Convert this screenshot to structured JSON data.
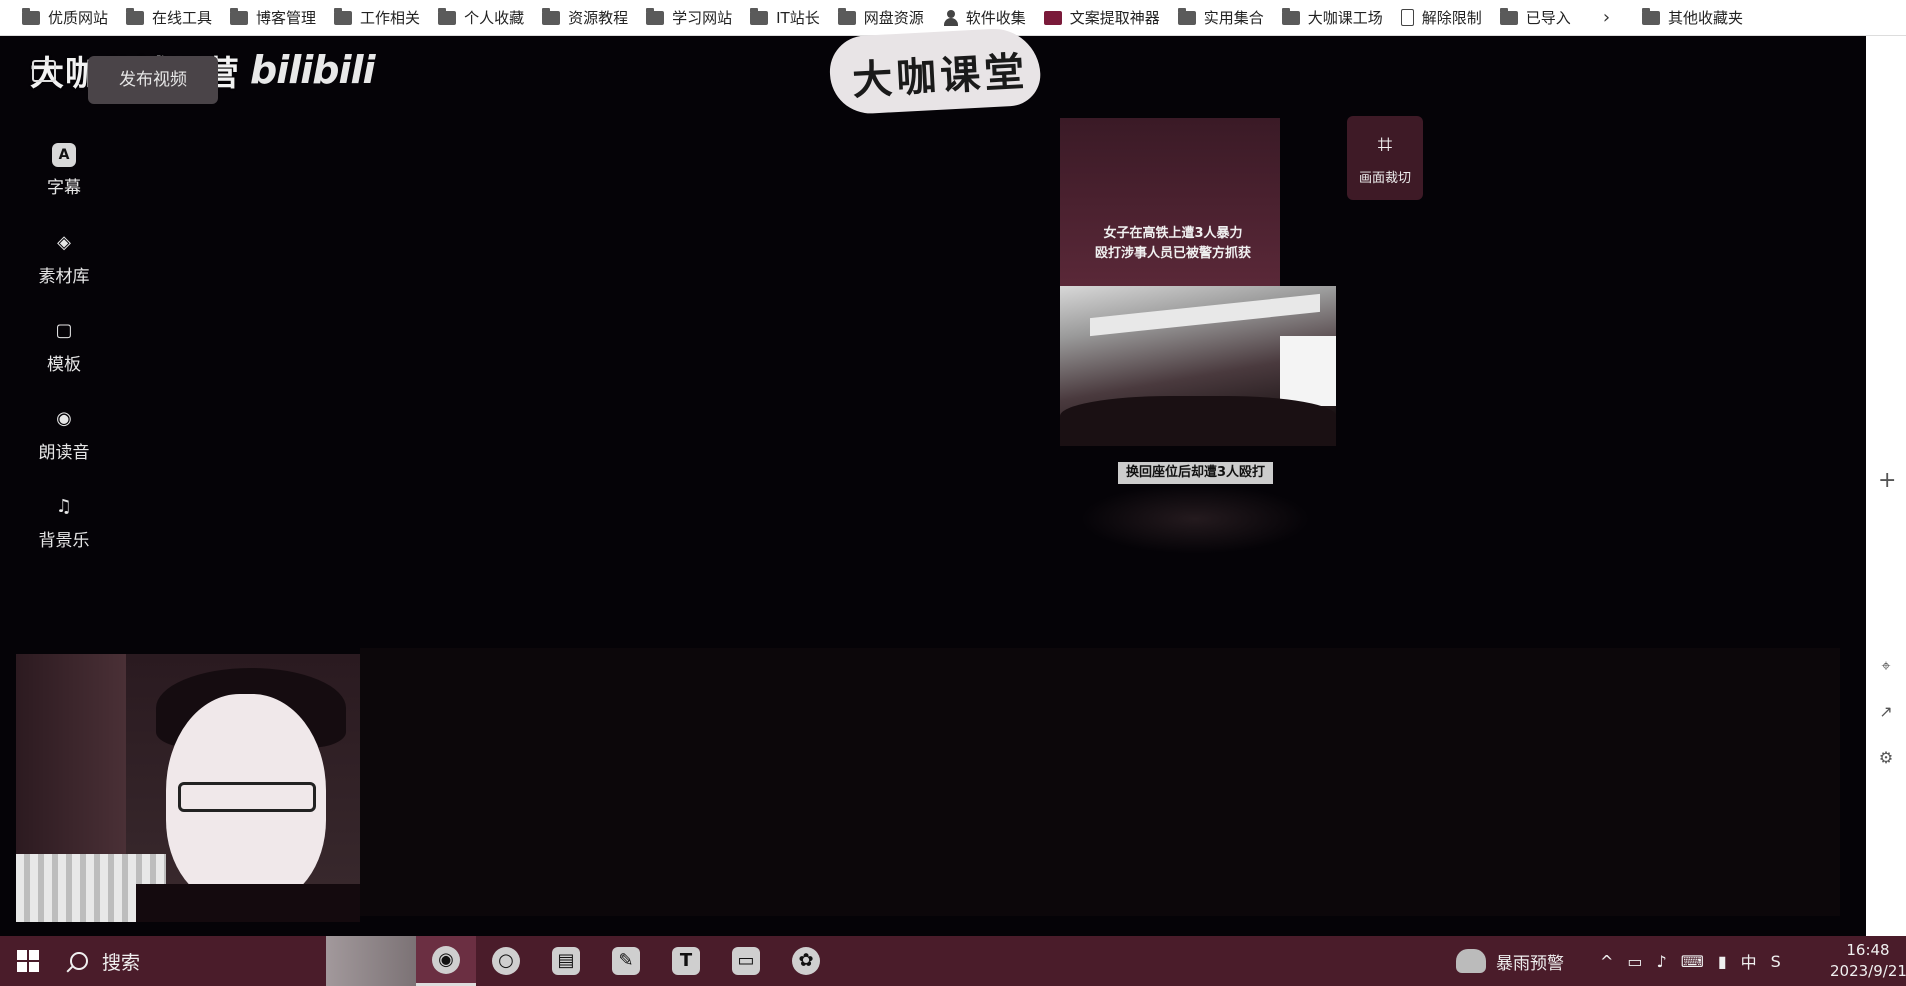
{
  "bookmarks": [
    {
      "label": "优质网站",
      "icon": "folder"
    },
    {
      "label": "在线工具",
      "icon": "folder"
    },
    {
      "label": "博客管理",
      "icon": "folder"
    },
    {
      "label": "工作相关",
      "icon": "folder"
    },
    {
      "label": "个人收藏",
      "icon": "folder"
    },
    {
      "label": "资源教程",
      "icon": "folder"
    },
    {
      "label": "学习网站",
      "icon": "folder"
    },
    {
      "label": "IT站长",
      "icon": "folder"
    },
    {
      "label": "网盘资源",
      "icon": "folder"
    },
    {
      "label": "软件收集",
      "icon": "person"
    },
    {
      "label": "文案提取神器",
      "icon": "app"
    },
    {
      "label": "实用集合",
      "icon": "folder"
    },
    {
      "label": "大咖课工场",
      "icon": "folder"
    },
    {
      "label": "解除限制",
      "icon": "doc"
    },
    {
      "label": "已导入",
      "icon": "folder"
    }
  ],
  "bookmarks_more": "›",
  "bookmarks_other": "其他收藏夹",
  "header": {
    "brand": "大咖私域运营",
    "bili": "bilibili",
    "publish_label": "发布视频",
    "logo_text": "大咖课堂"
  },
  "sidenav": [
    {
      "label": "字幕",
      "icon": "A",
      "active": true
    },
    {
      "label": "素材库",
      "icon": "◈"
    },
    {
      "label": "模板",
      "icon": "▢"
    },
    {
      "label": "朗读音",
      "icon": "◉"
    },
    {
      "label": "背景乐",
      "icon": "♫"
    }
  ],
  "preview": {
    "caption_line1": "女子在高铁上遭3人暴力",
    "caption_line2": "殴打涉事人员已被警方抓获",
    "subtitle": "换回座位后却遭3人殴打"
  },
  "crop": {
    "label": "画面裁切",
    "icon": "⌗"
  },
  "right_strip": {
    "plus": "+"
  },
  "taskbar": {
    "search_label": "搜索",
    "weather": "暴雨预警",
    "tray_ime": "中",
    "tray_s": "S",
    "time": "16:48",
    "date": "2023/9/21",
    "apps": [
      {
        "name": "recorder-app",
        "glyph": "◉",
        "active": true,
        "round": true
      },
      {
        "name": "chrome-app",
        "glyph": "○",
        "round": true
      },
      {
        "name": "notes-app",
        "glyph": "▤"
      },
      {
        "name": "editor-app",
        "glyph": "✎"
      },
      {
        "name": "typora-app",
        "glyph": "T"
      },
      {
        "name": "folder-app",
        "glyph": "▭"
      },
      {
        "name": "flower-app",
        "glyph": "✿",
        "round": true
      }
    ]
  }
}
